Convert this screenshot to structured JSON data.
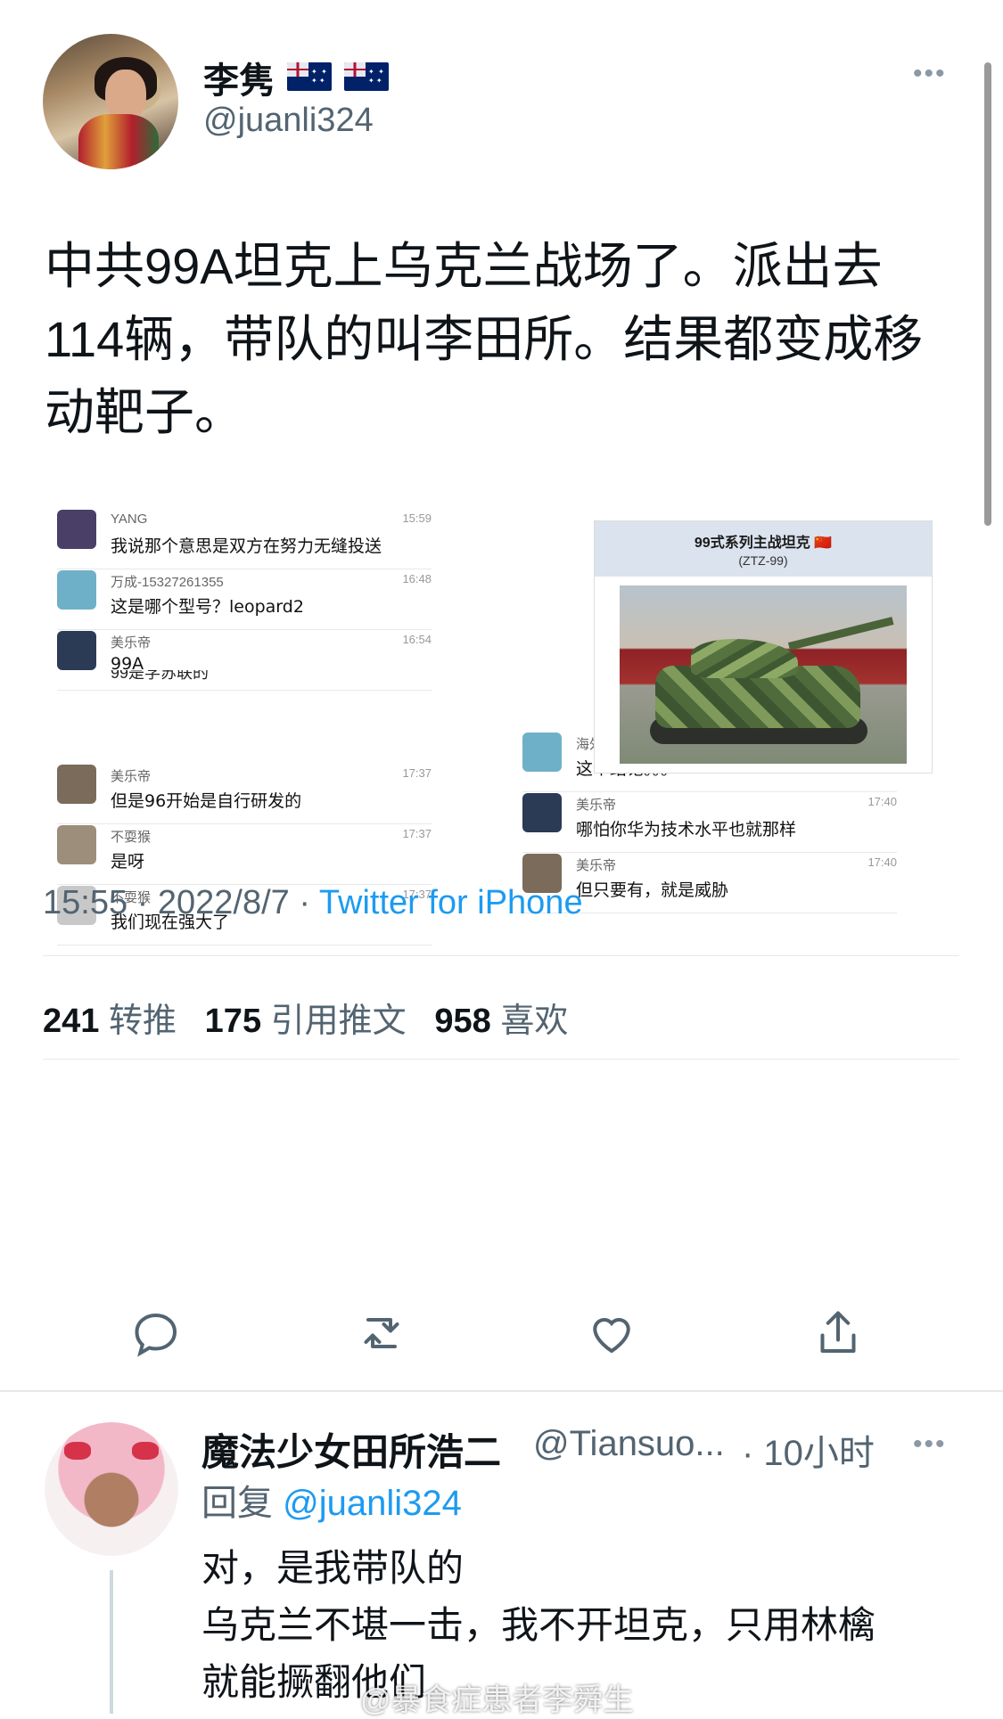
{
  "tweet": {
    "display_name": "李隽",
    "flags": [
      "🇦🇺",
      "🇦🇺"
    ],
    "handle": "@juanli324",
    "text": "中共99A坦克上乌克兰战场了。派出去114辆，带队的叫李田所。结果都变成移动靶子。",
    "time": "15:55",
    "date": "2022/8/7",
    "source": "Twitter for iPhone",
    "retweets_count": "241",
    "retweets_label": "转推",
    "quotes_count": "175",
    "quotes_label": "引用推文",
    "likes_count": "958",
    "likes_label": "喜欢"
  },
  "media": {
    "left_messages": [
      {
        "name": "YANG",
        "time": "15:59",
        "text": "我说那个意思是双方在努力无缝投送"
      },
      {
        "name": "万成-15327261355",
        "time": "16:48",
        "text": "这是哪个型号？leopard2"
      },
      {
        "name": "美乐帝",
        "time": "16:54",
        "text": "99A"
      },
      {
        "name": "美乐帝",
        "time": "17:37",
        "text": "但是96开始是自行研发的"
      },
      {
        "name": "不耍猴",
        "time": "17:37",
        "text": "是呀"
      },
      {
        "name": "不耍猴",
        "time": "17:37",
        "text": "我们现在强大了"
      }
    ],
    "left_partial": "99是学苏联的",
    "card_title": "99式系列主战坦克 🇨🇳",
    "card_subtitle": "(ZTZ-99)",
    "right_messages": [
      {
        "name": "海外孤忠",
        "time": "17:40",
        "text": "这个结论。。。"
      },
      {
        "name": "美乐帝",
        "time": "17:40",
        "text": "哪怕你华为技术水平也就那样"
      },
      {
        "name": "美乐帝",
        "time": "17:40",
        "text": "但只要有，就是威胁"
      }
    ]
  },
  "actions": [
    "reply-icon",
    "retweet-icon",
    "like-icon",
    "share-icon"
  ],
  "more_label": "•••",
  "reply": {
    "display_name": "魔法少女田所浩二",
    "handle": "@Tiansuo...",
    "time": "· 10小时",
    "reply_prefix": "回复",
    "reply_to": "@juanli324",
    "lines": [
      "对，是我带队的",
      "乌克兰不堪一击，我不开坦克，只用林檎",
      "就能撅翻他们"
    ]
  },
  "watermark": "@暴食症患者李舜生",
  "colors": {
    "accent": "#1d9bf0",
    "secondary_text": "#536471",
    "text": "#0f1419"
  }
}
